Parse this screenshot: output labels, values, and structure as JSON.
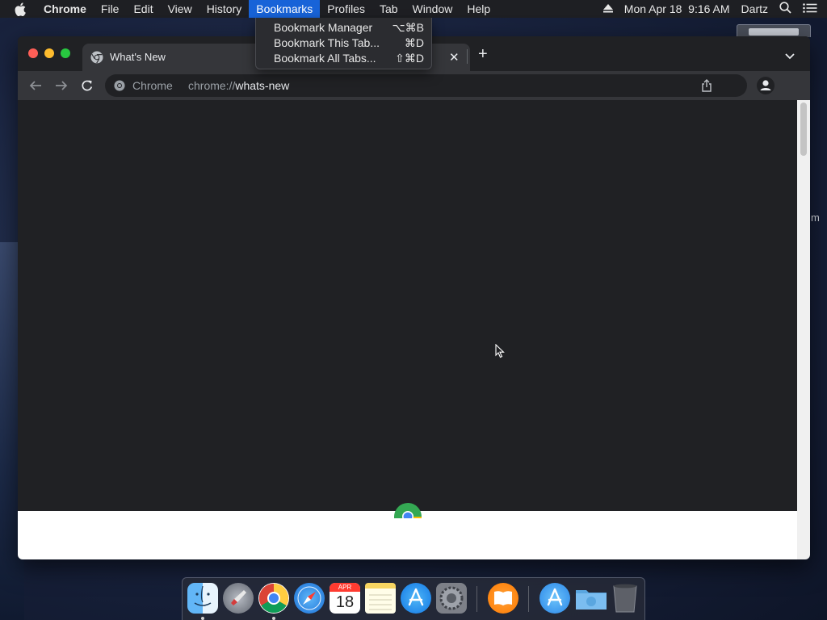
{
  "menubar": {
    "app_name": "Chrome",
    "items": [
      "File",
      "Edit",
      "View",
      "History",
      "Bookmarks",
      "Profiles",
      "Tab",
      "Window",
      "Help"
    ],
    "active_item": "Bookmarks",
    "clock": "Mon Apr 18  9:16 AM",
    "user": "Dartz"
  },
  "bookmarks_menu": {
    "items": [
      {
        "label": "Bookmark Manager",
        "shortcut": "⌥⌘B"
      },
      {
        "label": "Bookmark This Tab...",
        "shortcut": "⌘D"
      },
      {
        "label": "Bookmark All Tabs...",
        "shortcut": "⇧⌘D"
      }
    ]
  },
  "browser": {
    "tab_title": "What's New",
    "omnibox_chip": "Chrome",
    "url_scheme": "chrome://",
    "url_host": "whats-new"
  },
  "desktop": {
    "edge_text": "m"
  },
  "dock": {
    "items": [
      "Finder",
      "Launchpad",
      "Google Chrome",
      "Safari",
      "Calendar",
      "Notes",
      "App Store",
      "System Preferences",
      "Books",
      "Applications",
      "Downloads",
      "Trash"
    ],
    "calendar_month": "APR",
    "calendar_day": "18"
  },
  "colors": {
    "menu_highlight": "#1863d8",
    "tab_active": "#35363a",
    "window_bg": "#202124",
    "close_red": "#fe5f57",
    "minimize_yellow": "#febc2e",
    "zoom_green": "#28c840"
  }
}
